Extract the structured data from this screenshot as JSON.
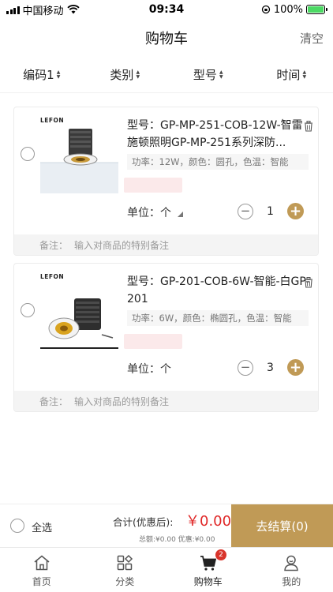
{
  "status_bar": {
    "carrier": "中国移动",
    "time": "09:34",
    "battery": "100%",
    "battery_level": 1.0
  },
  "nav": {
    "title": "购物车",
    "clear_label": "清空"
  },
  "sort_bar": {
    "items": [
      {
        "label": "编码1"
      },
      {
        "label": "类别"
      },
      {
        "label": "型号"
      },
      {
        "label": "时间"
      }
    ]
  },
  "cart": {
    "items": [
      {
        "brand": "LEFON",
        "title": "型号：GP-MP-251-COB-12W-智雷施顿照明GP-MP-251系列深防...",
        "spec": "功率：12W，颜色：圆孔，色温：智能",
        "unit": "单位：个",
        "quantity": "1",
        "remark_label": "备注：",
        "remark_placeholder": "输入对商品的特别备注"
      },
      {
        "brand": "LEFON",
        "title": "型号：GP-201-COB-6W-智能-白GP-201",
        "spec": "功率：6W，颜色：椭圆孔，色温：智能",
        "unit": "单位：个",
        "quantity": "3",
        "remark_label": "备注：",
        "remark_placeholder": "输入对商品的特别备注"
      }
    ]
  },
  "footer": {
    "select_all": "全选",
    "total_label": "合计(优惠后):",
    "total_value": "￥0.00",
    "subtotal": "总额:¥0.00 优惠:¥0.00",
    "checkout": "去结算(0)"
  },
  "tabbar": {
    "tabs": [
      {
        "label": "首页",
        "icon": "home-icon"
      },
      {
        "label": "分类",
        "icon": "category-icon"
      },
      {
        "label": "购物车",
        "icon": "cart-icon",
        "badge": "2"
      },
      {
        "label": "我的",
        "icon": "profile-icon"
      }
    ]
  },
  "colors": {
    "accent": "#c09a56",
    "price": "#e02828",
    "badge": "#d9342b"
  }
}
